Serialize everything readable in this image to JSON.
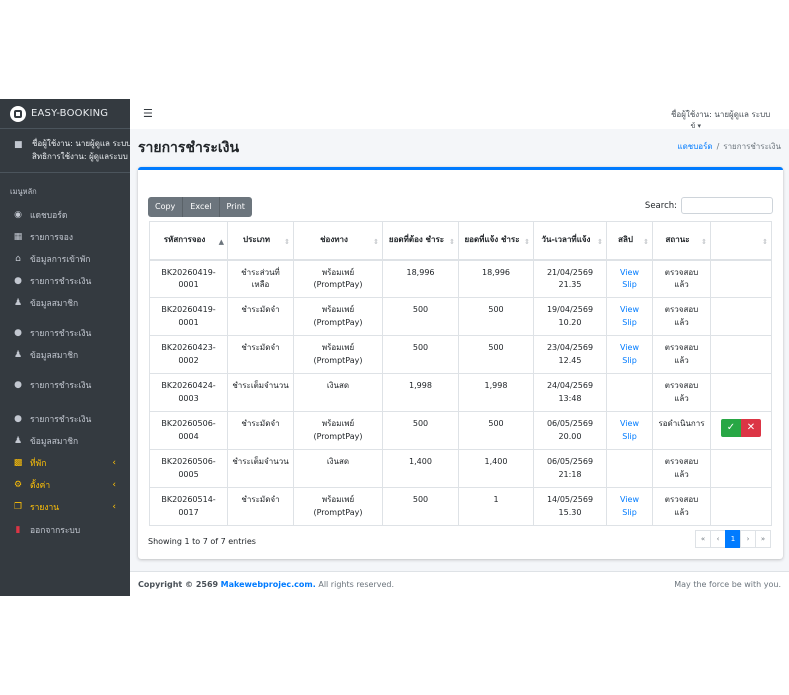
{
  "brand": {
    "name": "EASY-BOOKING"
  },
  "user_panel": {
    "name_line": "ชื่อผู้ใช้งาน: นายผู้ดูแล ระบบ",
    "role_line": "สิทธิการใช้งาน: ผู้ดูแลระบบ"
  },
  "sidebar": {
    "header": "เมนูหลัก",
    "items": [
      {
        "label": "แดชบอร์ด",
        "icon": "dashboard-icon"
      },
      {
        "label": "รายการจอง",
        "icon": "calendar-icon"
      },
      {
        "label": "ข้อมูลการเข้าพัก",
        "icon": "home-icon"
      },
      {
        "label": "รายการชำระเงิน",
        "icon": "money-icon"
      },
      {
        "label": "ข้อมูลสมาชิก",
        "icon": "users-icon"
      },
      {
        "label": "รายการชำระเงิน",
        "icon": "money-icon"
      },
      {
        "label": "ข้อมูลสมาชิก",
        "icon": "users-icon"
      },
      {
        "label": "รายการชำระเงิน",
        "icon": "money-icon"
      },
      {
        "label": "รายการชำระเงิน",
        "icon": "money-icon"
      },
      {
        "label": "ข้อมูลสมาชิก",
        "icon": "users-icon"
      },
      {
        "label": "ที่พัก",
        "icon": "building-icon"
      },
      {
        "label": "ตั้งค่า",
        "icon": "cogs-icon"
      },
      {
        "label": "รายงาน",
        "icon": "copy-icon"
      },
      {
        "label": "ออกจากระบบ",
        "icon": "book-icon"
      }
    ]
  },
  "topbar": {
    "user_label": "ชื่อผู้ใช้งาน: นายผู้ดูแล ระบบ",
    "user_sub": "ข้ ▾"
  },
  "page": {
    "title": "รายการชำระเงิน",
    "breadcrumb_home": "แดชบอร์ด",
    "breadcrumb_sep": "/",
    "breadcrumb_current": "รายการชำระเงิน"
  },
  "toolbar": {
    "copy": "Copy",
    "excel": "Excel",
    "print": "Print"
  },
  "search": {
    "label": "Search:",
    "value": "",
    "placeholder": ""
  },
  "table": {
    "headers": [
      "รหัสการจอง",
      "ประเภท",
      "ช่องทาง",
      "ยอดที่ต้อง ชำระ",
      "ยอดที่แจ้ง ชำระ",
      "วัน-เวลาที่แจ้ง",
      "สลิป",
      "สถานะ",
      ""
    ],
    "rows": [
      {
        "code_a": "BK20260419-",
        "code_b": "0001",
        "type_a": "ชำระส่วนที่",
        "type_b": "เหลือ",
        "ch_a": "พร้อมเพย์",
        "ch_b": "(PromptPay)",
        "due": "18,996",
        "paid": "18,996",
        "date": "21/04/2569",
        "time": "21.35",
        "slip_a": "View",
        "slip_b": "Slip",
        "st_a": "ตรวจสอบ",
        "st_b": "แล้ว"
      },
      {
        "code_a": "BK20260419-",
        "code_b": "0001",
        "type_a": "ชำระมัดจำ",
        "type_b": "",
        "ch_a": "พร้อมเพย์",
        "ch_b": "(PromptPay)",
        "due": "500",
        "paid": "500",
        "date": "19/04/2569",
        "time": "10.20",
        "slip_a": "View",
        "slip_b": "Slip",
        "st_a": "ตรวจสอบ",
        "st_b": "แล้ว"
      },
      {
        "code_a": "BK20260423-",
        "code_b": "0002",
        "type_a": "ชำระมัดจำ",
        "type_b": "",
        "ch_a": "พร้อมเพย์",
        "ch_b": "(PromptPay)",
        "due": "500",
        "paid": "500",
        "date": "23/04/2569",
        "time": "12.45",
        "slip_a": "View",
        "slip_b": "Slip",
        "st_a": "ตรวจสอบ",
        "st_b": "แล้ว"
      },
      {
        "code_a": "BK20260424-",
        "code_b": "0003",
        "type_a": "ชำระเต็มจำนวน",
        "type_b": "",
        "ch_a": "เงินสด",
        "ch_b": "",
        "due": "1,998",
        "paid": "1,998",
        "date": "24/04/2569",
        "time": "13:48",
        "slip_a": "",
        "slip_b": "",
        "st_a": "ตรวจสอบ",
        "st_b": "แล้ว"
      },
      {
        "code_a": "BK20260506-",
        "code_b": "0004",
        "type_a": "ชำระมัดจำ",
        "type_b": "",
        "ch_a": "พร้อมเพย์",
        "ch_b": "(PromptPay)",
        "due": "500",
        "paid": "500",
        "date": "06/05/2569",
        "time": "20.00",
        "slip_a": "View",
        "slip_b": "Slip",
        "st_a": "รอดำเนินการ",
        "st_b": "",
        "actions": true
      },
      {
        "code_a": "BK20260506-",
        "code_b": "0005",
        "type_a": "ชำระเต็มจำนวน",
        "type_b": "",
        "ch_a": "เงินสด",
        "ch_b": "",
        "due": "1,400",
        "paid": "1,400",
        "date": "06/05/2569",
        "time": "21:18",
        "slip_a": "",
        "slip_b": "",
        "st_a": "ตรวจสอบ",
        "st_b": "แล้ว"
      },
      {
        "code_a": "BK20260514-",
        "code_b": "0017",
        "type_a": "ชำระมัดจำ",
        "type_b": "",
        "ch_a": "พร้อมเพย์",
        "ch_b": "(PromptPay)",
        "due": "500",
        "paid": "1",
        "date": "14/05/2569",
        "time": "15.30",
        "slip_a": "View",
        "slip_b": "Slip",
        "st_a": "ตรวจสอบ",
        "st_b": "แล้ว"
      }
    ]
  },
  "info": "Showing 1 to 7 of 7 entries",
  "pager": {
    "first": "«",
    "prev": "‹",
    "current": "1",
    "next": "›",
    "last": "»"
  },
  "footer": {
    "copyright": "Copyright © 2569",
    "brand": "Makewebprojec.com.",
    "rights": "All rights reserved.",
    "right_text": "May the force be with you."
  },
  "colors": {
    "primary": "#007bff",
    "success": "#28a745",
    "danger": "#dc3545",
    "sidebar": "#343a40",
    "warning": "#ffc107"
  }
}
